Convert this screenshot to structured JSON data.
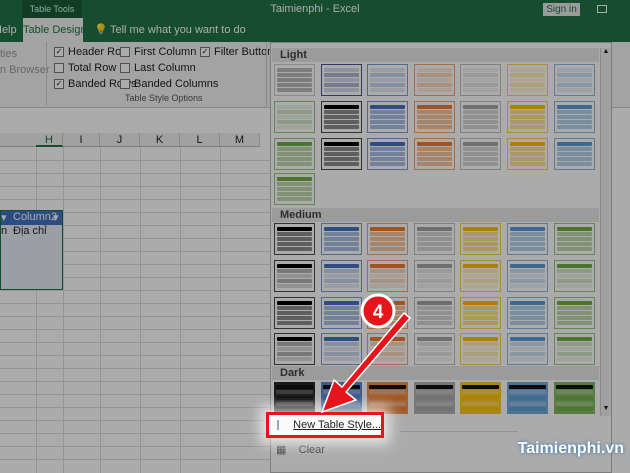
{
  "titlebar": {
    "context_tab": "Table Tools",
    "title": "Taimienphi  -  Excel",
    "sign_in": "Sign in"
  },
  "tabs": {
    "help": "Help",
    "table_design": "Table Design",
    "tell_me": "Tell me what you want to do"
  },
  "ribbon": {
    "partial_1": "ties",
    "partial_2": "n Browser",
    "options": [
      {
        "label": "Header Row",
        "checked": true
      },
      {
        "label": "Total Row",
        "checked": false
      },
      {
        "label": "Banded Rows",
        "checked": true
      },
      {
        "label": "First Column",
        "checked": false
      },
      {
        "label": "Last Column",
        "checked": false
      },
      {
        "label": "Banded Columns",
        "checked": false
      },
      {
        "label": "Filter Button",
        "checked": true
      }
    ],
    "group_label": "Table Style Options"
  },
  "sheet": {
    "columns": [
      "H",
      "I",
      "J",
      "K",
      "L",
      "M"
    ],
    "table_header": "Column2",
    "table_cell": "Địa chỉ",
    "partial_cell": "n"
  },
  "gallery": {
    "sections": {
      "light": "Light",
      "medium": "Medium",
      "dark": "Dark"
    },
    "colors": [
      "#000000",
      "#4472c4",
      "#ed7d31",
      "#a5a5a5",
      "#ffc000",
      "#5b9bd5",
      "#70ad47"
    ],
    "new_table_style": "New Table Style...",
    "clear": "Clear"
  },
  "annotation": {
    "step": "4",
    "accent": "#e8141c"
  },
  "watermark": "Taimienphi.vn"
}
